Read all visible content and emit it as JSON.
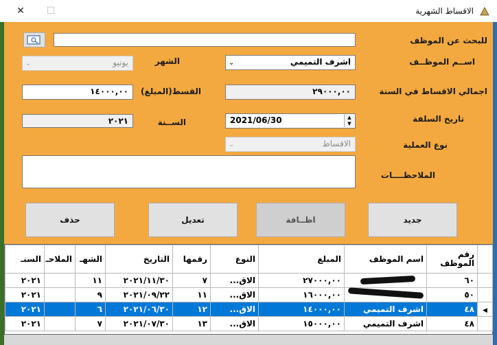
{
  "window": {
    "title": "الاقساط الشهرية",
    "close": "✕",
    "maximize": "☐",
    "minimize": ""
  },
  "labels": {
    "search": "للبحث عن الموظف",
    "employee_name": "اســم الموظــف",
    "month": "الشهر",
    "total_installments": "اجمالي الاقساط في السنة",
    "installment_amount": "القسط(المبلغ)",
    "advance_date": "تاريخ السلفة",
    "year": "الســنة",
    "operation_type": "نوع العملية",
    "notes": "الملاحظــــات"
  },
  "fields": {
    "search_value": "",
    "employee_name": "اشرف التميمي",
    "month": "يونيو",
    "total_installments": "٢٩٠٠٠,٠٠",
    "installment_amount": "١٤٠٠٠,٠٠",
    "advance_date": "2021/06/30",
    "year": "٢٠٢١",
    "operation_type": "الاقساط",
    "notes": ""
  },
  "buttons": {
    "new": "جديد",
    "add": "اظــافة",
    "edit": "تعديل",
    "delete": "حذف"
  },
  "grid": {
    "columns": [
      "رقم الموظف",
      "اسم الموظف",
      "المبلغ",
      "النوع",
      "رقمها",
      "التاريخ",
      "الشهر",
      "الملاحظات",
      "السنة"
    ],
    "column_headers_visible": [
      "رقم\nالموظف",
      "اسم الموظف",
      "المبلغ",
      "النوع",
      "رقمها",
      "التاريخ",
      "الشهـ",
      "الملاحـ",
      "السنـ"
    ],
    "rows": [
      {
        "id": "٦٠",
        "name": "",
        "amount": "٢٧٠٠٠,٠٠",
        "type": "الاق...",
        "num": "٧",
        "date": "٢٠٢١/١١/٣٠",
        "month": "١١",
        "notes": "",
        "year": "٢٠٢١",
        "selected": false
      },
      {
        "id": "٥٠",
        "name": "",
        "amount": "١٦٠٠٠,٠٠",
        "type": "الاق...",
        "num": "١١",
        "date": "٢٠٢١/٠٩/٢٢",
        "month": "٩",
        "notes": "",
        "year": "٢٠٢١",
        "selected": false
      },
      {
        "id": "٤٨",
        "name": "اشرف التميمي",
        "amount": "١٤٠٠٠,٠٠",
        "type": "الاق...",
        "num": "١٢",
        "date": "٢٠٢١/٠٦/٣٠",
        "month": "٦",
        "notes": "",
        "year": "٢٠٢١",
        "selected": true
      },
      {
        "id": "٤٨",
        "name": "اشرف التميمي",
        "amount": "١٥٠٠٠,٠٠",
        "type": "الاق...",
        "num": "١٣",
        "date": "٢٠٢١/٠٧/٣٠",
        "month": "٧",
        "notes": "",
        "year": "٢٠٢١",
        "selected": false
      }
    ]
  },
  "colors": {
    "form_bg": "#f4a940",
    "selection": "#0078d7"
  }
}
